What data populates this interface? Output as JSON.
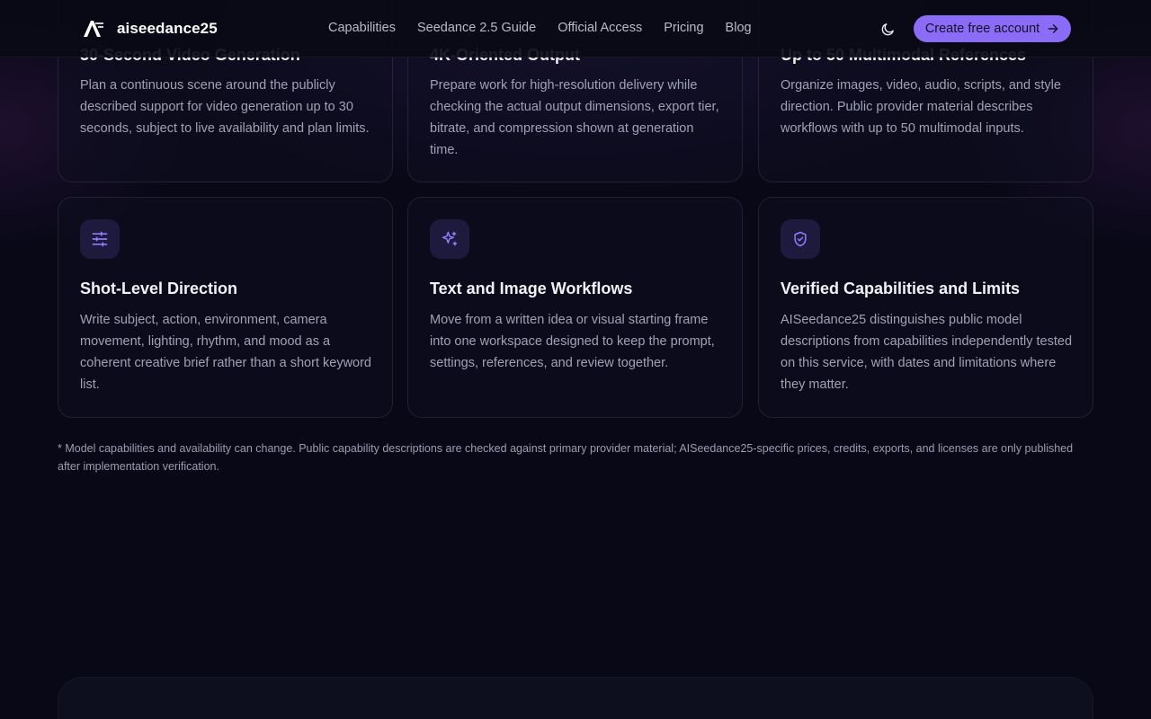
{
  "header": {
    "brand": "aiseedance25",
    "nav": [
      "Capabilities",
      "Seedance 2.5 Guide",
      "Official Access",
      "Pricing",
      "Blog"
    ],
    "cta_label": "Create free account"
  },
  "cards_top": [
    {
      "title": "30-Second Video Generation",
      "body": "Plan a continuous scene around the publicly described support for video generation up to 30 seconds, subject to live availability and plan limits."
    },
    {
      "title": "4K-Oriented Output",
      "body": "Prepare work for high-resolution delivery while checking the actual output dimensions, export tier, bitrate, and compression shown at generation time."
    },
    {
      "title": "Up to 50 Multimodal References",
      "body": "Organize images, video, audio, scripts, and style direction. Public provider material describes workflows with up to 50 multimodal inputs."
    }
  ],
  "cards_bottom": [
    {
      "icon": "sliders-icon",
      "title": "Shot-Level Direction",
      "body": "Write subject, action, environment, camera movement, lighting, rhythm, and mood as a coherent creative brief rather than a short keyword list."
    },
    {
      "icon": "sparkles-icon",
      "title": "Text and Image Workflows",
      "body": "Move from a written idea or visual starting frame into one workspace designed to keep the prompt, settings, references, and review together."
    },
    {
      "icon": "shield-check-icon",
      "title": "Verified Capabilities and Limits",
      "body": "AISeedance25 distinguishes public model descriptions from capabilities independently tested on this service, with dates and limitations where they matter."
    }
  ],
  "footnote": "* Model capabilities and availability can change. Public capability descriptions are checked against primary provider material; AISeedance25-specific prices, credits, exports, and licenses are only published after implementation verification.",
  "colors": {
    "background": "#080816",
    "accent": "#8b6cf6",
    "icon": "#8f7cf8"
  }
}
